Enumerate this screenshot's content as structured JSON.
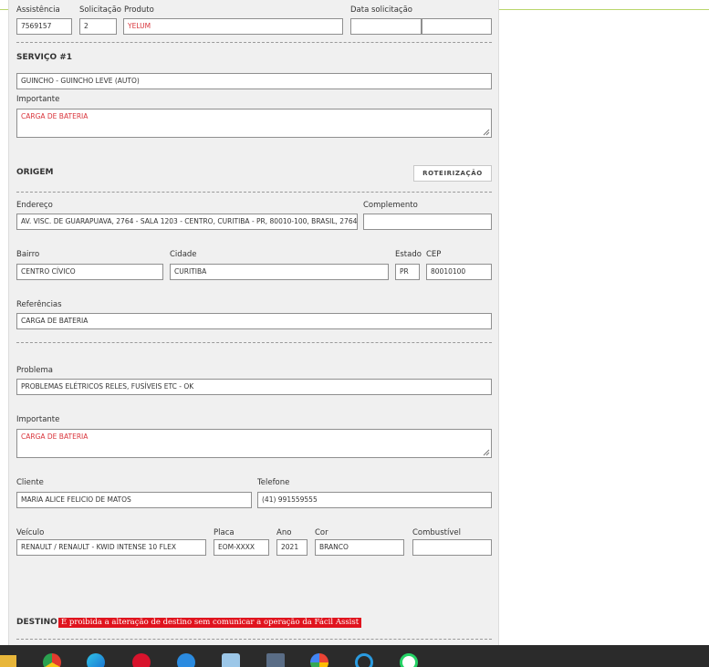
{
  "labels": {
    "assistencia": "Assistência",
    "solicitacao": "Solicitação",
    "produto": "Produto",
    "data_solicitacao": "Data solicitação",
    "importante": "Importante",
    "endereco": "Endereço",
    "complemento": "Complemento",
    "bairro": "Bairro",
    "cidade": "Cidade",
    "estado": "Estado",
    "cep": "CEP",
    "referencias": "Referências",
    "problema": "Problema",
    "cliente": "Cliente",
    "telefone": "Telefone",
    "veiculo": "Veículo",
    "placa": "Placa",
    "ano": "Ano",
    "cor": "Cor",
    "combustivel": "Combustível"
  },
  "header_fields": {
    "assistencia": "7569157",
    "solicitacao": "2",
    "produto": "YELUM",
    "data_solicitacao_date": "",
    "data_solicitacao_time": ""
  },
  "servico": {
    "title": "SERVIÇO #1",
    "service_type": "GUINCHO - GUINCHO LEVE (AUTO)",
    "importante": "CARGA DE BATERIA"
  },
  "origem": {
    "title": "ORIGEM",
    "route_button": "ROTEIRIZAÇÃO",
    "endereco": "AV. VISC. DE GUARAPUAVA, 2764 - SALA 1203 - CENTRO, CURITIBA - PR, 80010-100, BRASIL, 2764",
    "complemento": "",
    "bairro": "CENTRO CÍVICO",
    "cidade": "CURITIBA",
    "estado": "PR",
    "cep": "80010100",
    "referencias": "CARGA DE BATERIA"
  },
  "problema": {
    "problema": "PROBLEMAS ELÉTRICOS RELES, FUSÍVEIS ETC - OK",
    "importante": "CARGA DE BATERIA"
  },
  "cliente": {
    "nome": "MARIA ALICE FELICIO DE MATOS",
    "telefone": "(41) 991559555"
  },
  "veiculo": {
    "modelo": "RENAULT / RENAULT - KWID INTENSE 10 FLEX",
    "placa": "EOM-XXXX",
    "ano": "2021",
    "cor": "BRANCO",
    "combustivel": ""
  },
  "destino": {
    "title": "DESTINO",
    "warning": "É proibida a alteração de destino sem comunicar a operação da Fácil Assist"
  },
  "taskbar": {
    "icons": [
      "folder-icon",
      "chrome-icon",
      "edge-icon",
      "opera-icon",
      "phone-icon",
      "pen-icon",
      "calculator-icon",
      "maps-icon",
      "cortana-icon",
      "whatsapp-icon"
    ]
  },
  "colors": {
    "accent_red": "#d9343b",
    "warning_bg": "#e0141e",
    "panel_bg": "#f0f0f0",
    "top_line": "#b9d66b"
  }
}
